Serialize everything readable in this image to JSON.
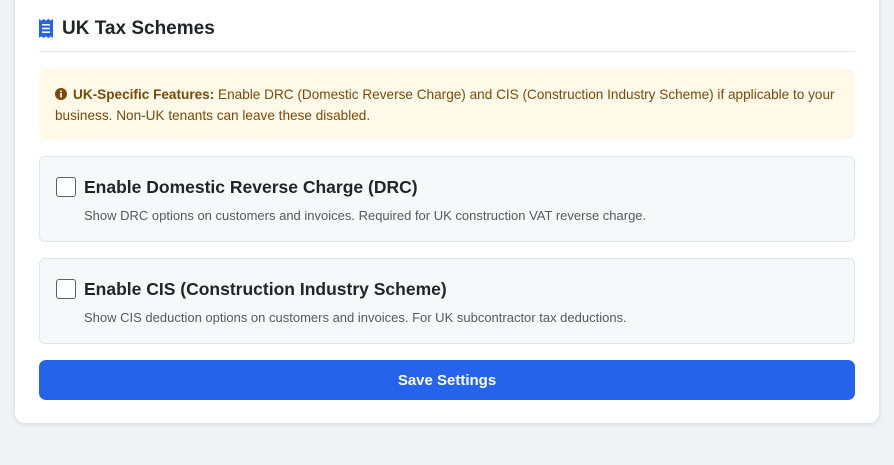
{
  "section": {
    "title": "UK Tax Schemes",
    "icon": "receipt-icon",
    "icon_color": "#2563eb"
  },
  "alert": {
    "icon": "info-circle-icon",
    "bold_label": "UK-Specific Features:",
    "message": " Enable DRC (Domestic Reverse Charge) and CIS (Construction Industry Scheme) if applicable to your business. Non-UK tenants can leave these disabled.",
    "background": "#fef9e8",
    "text_color": "#7a4a0b"
  },
  "options": [
    {
      "label": "Enable Domestic Reverse Charge (DRC)",
      "description": "Show DRC options on customers and invoices. Required for UK construction VAT reverse charge.",
      "checked": false
    },
    {
      "label": "Enable CIS (Construction Industry Scheme)",
      "description": "Show CIS deduction options on customers and invoices. For UK subcontractor tax deductions.",
      "checked": false
    }
  ],
  "save_button": {
    "label": "Save Settings",
    "color": "#2563eb"
  }
}
